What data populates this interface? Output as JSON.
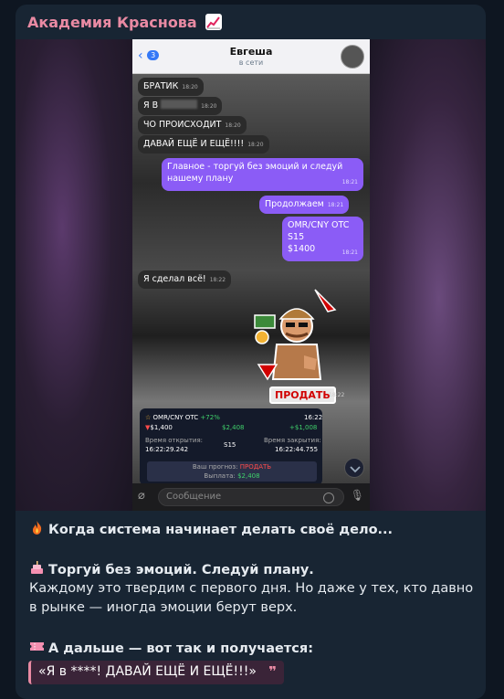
{
  "channel": {
    "name": "Академия Краснова",
    "emoji": "chart-increasing-icon",
    "color": "#e98aa3"
  },
  "screenshot": {
    "header": {
      "back_count": "3",
      "contact_name": "Евгеша",
      "status": "в сети"
    },
    "messages": [
      {
        "dir": "in",
        "text": "БРАТИК",
        "time": "18:20"
      },
      {
        "dir": "in",
        "text": "Я В",
        "time": "18:20",
        "blurred": true
      },
      {
        "dir": "in",
        "text": "ЧО ПРОИСХОДИТ",
        "time": "18:20"
      },
      {
        "dir": "in",
        "text": "ДАВАЙ ЕЩЁ И ЕЩЁ!!!!",
        "time": "18:20"
      },
      {
        "dir": "out",
        "line1": "Главное - торгуй без эмоций и следуй",
        "line2": "нашему плану",
        "time": "18:21"
      },
      {
        "dir": "out",
        "text": "Продолжаем",
        "time": "18:21"
      },
      {
        "dir": "out",
        "line1": "OMR/CNY OTC",
        "line2": "S15",
        "line3": "$1400",
        "time": "18:21"
      },
      {
        "dir": "in",
        "text": "Я сделал всё!",
        "time": "18:22"
      }
    ],
    "sticker_label": "ПРОДАТЬ",
    "sticker_time": "18:22",
    "trade_card": {
      "pair": "OMR/CNY OTC",
      "percent": "+72%",
      "time": "16:22",
      "amount": "$1,400",
      "payout": "$2,408",
      "profit": "+$1,008",
      "open_label": "Время открытия:",
      "open_time": "16:22:29.242",
      "duration": "S15",
      "close_label": "Время закрытия:",
      "close_time": "16:22:44.755",
      "forecast_label": "Ваш прогноз:",
      "forecast_value": "ПРОДАТЬ",
      "payout_label": "Выплата:",
      "payout_value": "$2,408"
    },
    "input_placeholder": "Сообщение"
  },
  "caption": {
    "line1": "Когда система начинает делать своё дело...",
    "line1_emoji": "fire-icon",
    "line2": "Торгуй без эмоций. Следуй плану.",
    "line2_emoji": "cake-icon",
    "line3": "Каждому это твердим с первого дня. Но даже у тех, кто давно",
    "line4": "в рынке — иногда эмоции берут верх.",
    "line5": "А дальше — вот так и получается:",
    "line5_emoji": "ticket-icon",
    "quote": "«Я в ****! ДАВАЙ ЕЩЁ И ЕЩЁ!!!»",
    "quote_mark": "❞"
  }
}
